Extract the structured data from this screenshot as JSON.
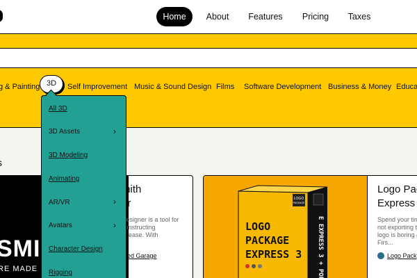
{
  "nav": {
    "items": [
      {
        "label": "Home",
        "active": true
      },
      {
        "label": "About"
      },
      {
        "label": "Features"
      },
      {
        "label": "Pricing"
      },
      {
        "label": "Taxes"
      }
    ]
  },
  "categories": [
    {
      "label": "g & Painting"
    },
    {
      "label": "3D",
      "active": true
    },
    {
      "label": "Self Improvement"
    },
    {
      "label": "Music & Sound Design"
    },
    {
      "label": "Films"
    },
    {
      "label": "Software Development"
    },
    {
      "label": "Business & Money"
    },
    {
      "label": "Educati"
    }
  ],
  "dropdown": {
    "items": [
      {
        "label": "All 3D",
        "link": true
      },
      {
        "label": "3D Assets",
        "chevron": "›"
      },
      {
        "label": "3D Modeling",
        "link": true
      },
      {
        "label": "Animating",
        "link": true
      },
      {
        "label": "AR/VR",
        "chevron": "›"
      },
      {
        "label": "Avatars",
        "chevron": "›"
      },
      {
        "label": "Character Design",
        "link": true
      },
      {
        "label": "Rigging",
        "link": true
      }
    ]
  },
  "section": {
    "title_fragment": "s"
  },
  "cards": [
    {
      "title_l1": "mith",
      "title_l2": "er",
      "desc_l1": "Designer is a tool for",
      "desc_l2": "constructing",
      "desc_l3": "th ease. With",
      "desc_l4": "...",
      "author": "ored Garage",
      "image_text": "SMI",
      "image_sub": "RE MADE F"
    },
    {
      "title_l1": "Logo Pac",
      "title_l2": "Express",
      "desc_l1": "Spend your tim",
      "desc_l2": "not exporting t",
      "desc_l3": "logo is boring a",
      "desc_l4": "Firs...",
      "author": "Logo Pack",
      "box": {
        "badge_top": "LOGO",
        "badge_bottom": "PACKAGE",
        "front_l1": "LOGO",
        "front_l2": "PACKAGE",
        "front_l3": "EXPRESS 3",
        "spine": "E EXPRESS 3 + PORTAL"
      }
    }
  ],
  "colors": {
    "accent_yellow": "#ffc900",
    "dropdown_teal": "#23a094",
    "card_orange": "#f6a700"
  }
}
